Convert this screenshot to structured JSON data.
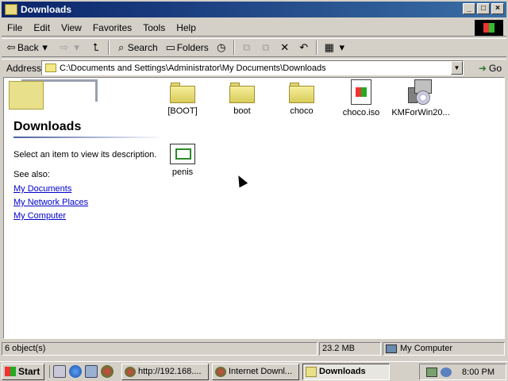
{
  "window": {
    "title": "Downloads",
    "buttons": {
      "minimize": "_",
      "maximize": "□",
      "close": "×"
    }
  },
  "menu": [
    "File",
    "Edit",
    "View",
    "Favorites",
    "Tools",
    "Help"
  ],
  "toolbar": {
    "back": "Back",
    "search": "Search",
    "folders": "Folders"
  },
  "address": {
    "label": "Address",
    "value": "C:\\Documents and Settings\\Administrator\\My Documents\\Downloads",
    "go": "Go"
  },
  "sidebar": {
    "title": "Downloads",
    "description": "Select an item to view its description.",
    "see_also": "See also:",
    "links": [
      "My Documents",
      "My Network Places",
      "My Computer"
    ]
  },
  "items": [
    {
      "name": "[BOOT]",
      "type": "folder"
    },
    {
      "name": "boot",
      "type": "folder"
    },
    {
      "name": "choco",
      "type": "folder"
    },
    {
      "name": "choco.iso",
      "type": "iso-file"
    },
    {
      "name": "KMForWin20...",
      "type": "application"
    },
    {
      "name": "penis",
      "type": "letter"
    }
  ],
  "status": {
    "count": "6 object(s)",
    "size": "23.2 MB",
    "zone": "My Computer"
  },
  "taskbar": {
    "start": "Start",
    "tasks": [
      "http://192.168....",
      "Internet Downl...",
      "Downloads"
    ],
    "clock": "8:00 PM"
  }
}
